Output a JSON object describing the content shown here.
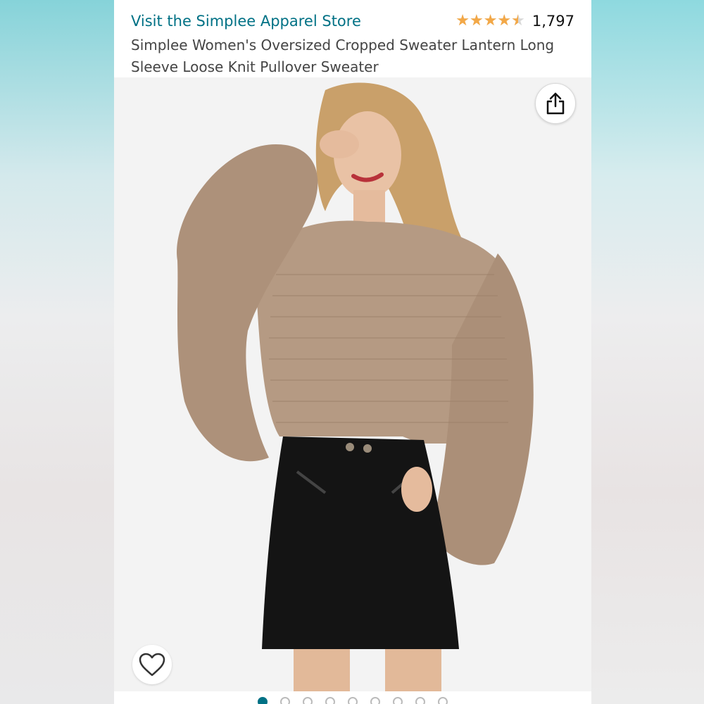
{
  "store": {
    "link_text": "Visit the Simplee Apparel Store"
  },
  "rating": {
    "stars": 4.5,
    "max_stars": 5,
    "count": "1,797"
  },
  "product": {
    "title": "Simplee Women's Oversized Cropped Sweater Lantern Long Sleeve Loose Knit Pullover Sweater"
  },
  "image": {
    "alt": "Model wearing oversized taupe knit sweater and black patent mini skirt"
  },
  "icons": {
    "share": "share-icon",
    "wishlist": "heart-icon"
  },
  "carousel": {
    "total": 9,
    "active_index": 0
  },
  "colors": {
    "link": "#007185",
    "star": "#f3a847",
    "sweater": "#b59a83",
    "skirt": "#141414"
  }
}
